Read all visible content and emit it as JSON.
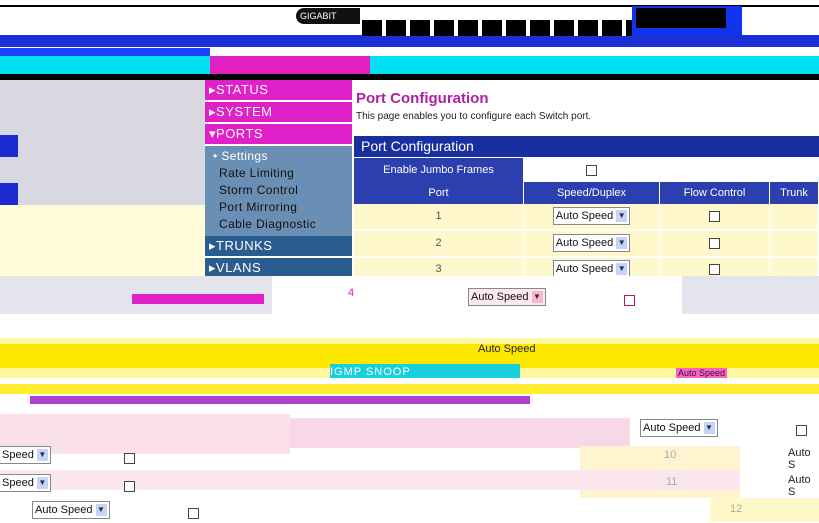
{
  "header": {
    "logo_text": "GIGABIT"
  },
  "nav": {
    "items": [
      {
        "label": "▸STATUS"
      },
      {
        "label": "▸SYSTEM"
      },
      {
        "label": "▾PORTS"
      },
      {
        "label": "▸TRUNKS"
      },
      {
        "label": "▸VLANS"
      }
    ],
    "sub_items": [
      {
        "label": "• Settings"
      },
      {
        "label": "Rate Limiting"
      },
      {
        "label": "Storm Control"
      },
      {
        "label": "Port Mirroring"
      },
      {
        "label": "Cable Diagnostic"
      }
    ]
  },
  "page": {
    "title": "Port Configuration",
    "description": "This page enables you to configure each Switch port."
  },
  "config": {
    "header": "Port Configuration",
    "jumbo_label": "Enable Jumbo Frames",
    "columns": [
      "Port",
      "Speed/Duplex",
      "Flow Control",
      "Trunk"
    ],
    "rows": [
      {
        "port": "1",
        "speed": "Auto Speed"
      },
      {
        "port": "2",
        "speed": "Auto Speed"
      },
      {
        "port": "3",
        "speed": "Auto Speed"
      },
      {
        "port": "4",
        "speed": "Auto Speed"
      }
    ]
  },
  "glitch": {
    "snoop_text": "IGMP SNOOP",
    "speed_a": "Auto Speed",
    "speed_b": "Auto Speed",
    "speed_c": "Speed",
    "speed_d": "Speed",
    "speed_e": "Auto Speed",
    "speed_f": "Auto S",
    "speed_g": "Auto S",
    "port10": "10",
    "port11": "11",
    "port12": "12"
  }
}
